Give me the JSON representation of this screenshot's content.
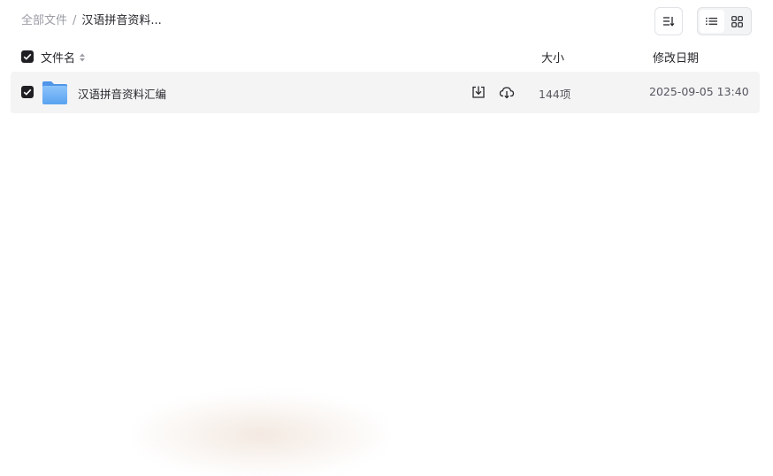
{
  "breadcrumb": {
    "root": "全部文件",
    "separator": "/",
    "current": "汉语拼音资料..."
  },
  "toolbar": {
    "sort_icon": "sort-icon",
    "list_view_icon": "list-view-icon",
    "grid_view_icon": "grid-view-icon",
    "active_view": "list"
  },
  "table": {
    "headers": {
      "name": "文件名",
      "size": "大小",
      "date": "修改日期"
    },
    "rows": [
      {
        "name": "汉语拼音资料汇编",
        "type": "folder",
        "size": "144项",
        "modified": "2025-09-05 13:40",
        "selected": true
      }
    ]
  },
  "colors": {
    "checkbox": "#1f1f23",
    "row_highlight": "#f4f4f5",
    "folder": "#6aaef5",
    "muted_text": "#9a9ca4"
  }
}
